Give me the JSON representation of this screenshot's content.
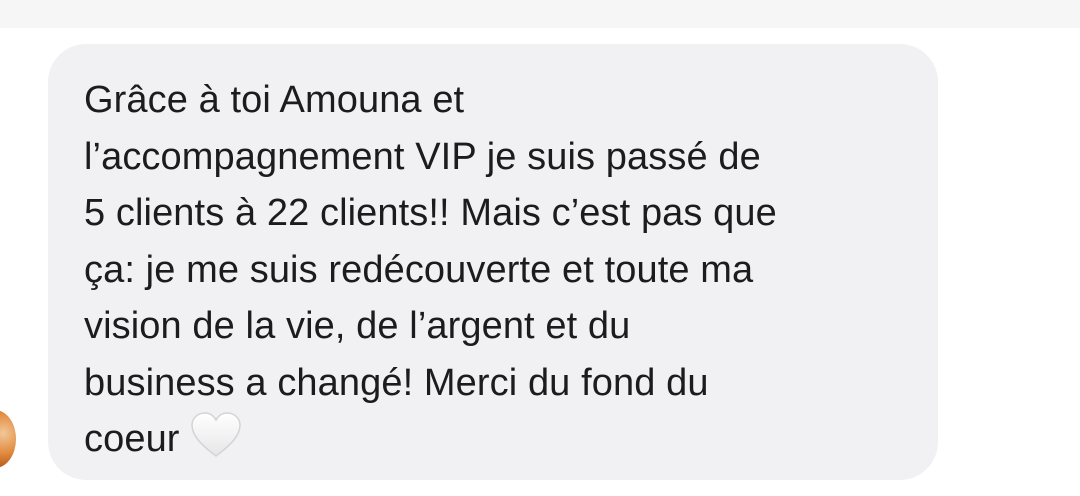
{
  "message": {
    "lines": [
      "Grâce à toi Amouna et",
      "l’accompagnement VIP je suis passé de",
      "5 clients à 22 clients!! Mais c’est pas que",
      "ça: je me suis redécouverte et toute ma",
      "vision de la vie, de l’argent et du",
      "business a changé! Merci du fond du",
      "coeur"
    ],
    "emoji": "white-heart-icon"
  },
  "colors": {
    "bubble": "#f1f1f3",
    "text": "#1c1c1e",
    "top_strip": "#f6f6f7"
  }
}
